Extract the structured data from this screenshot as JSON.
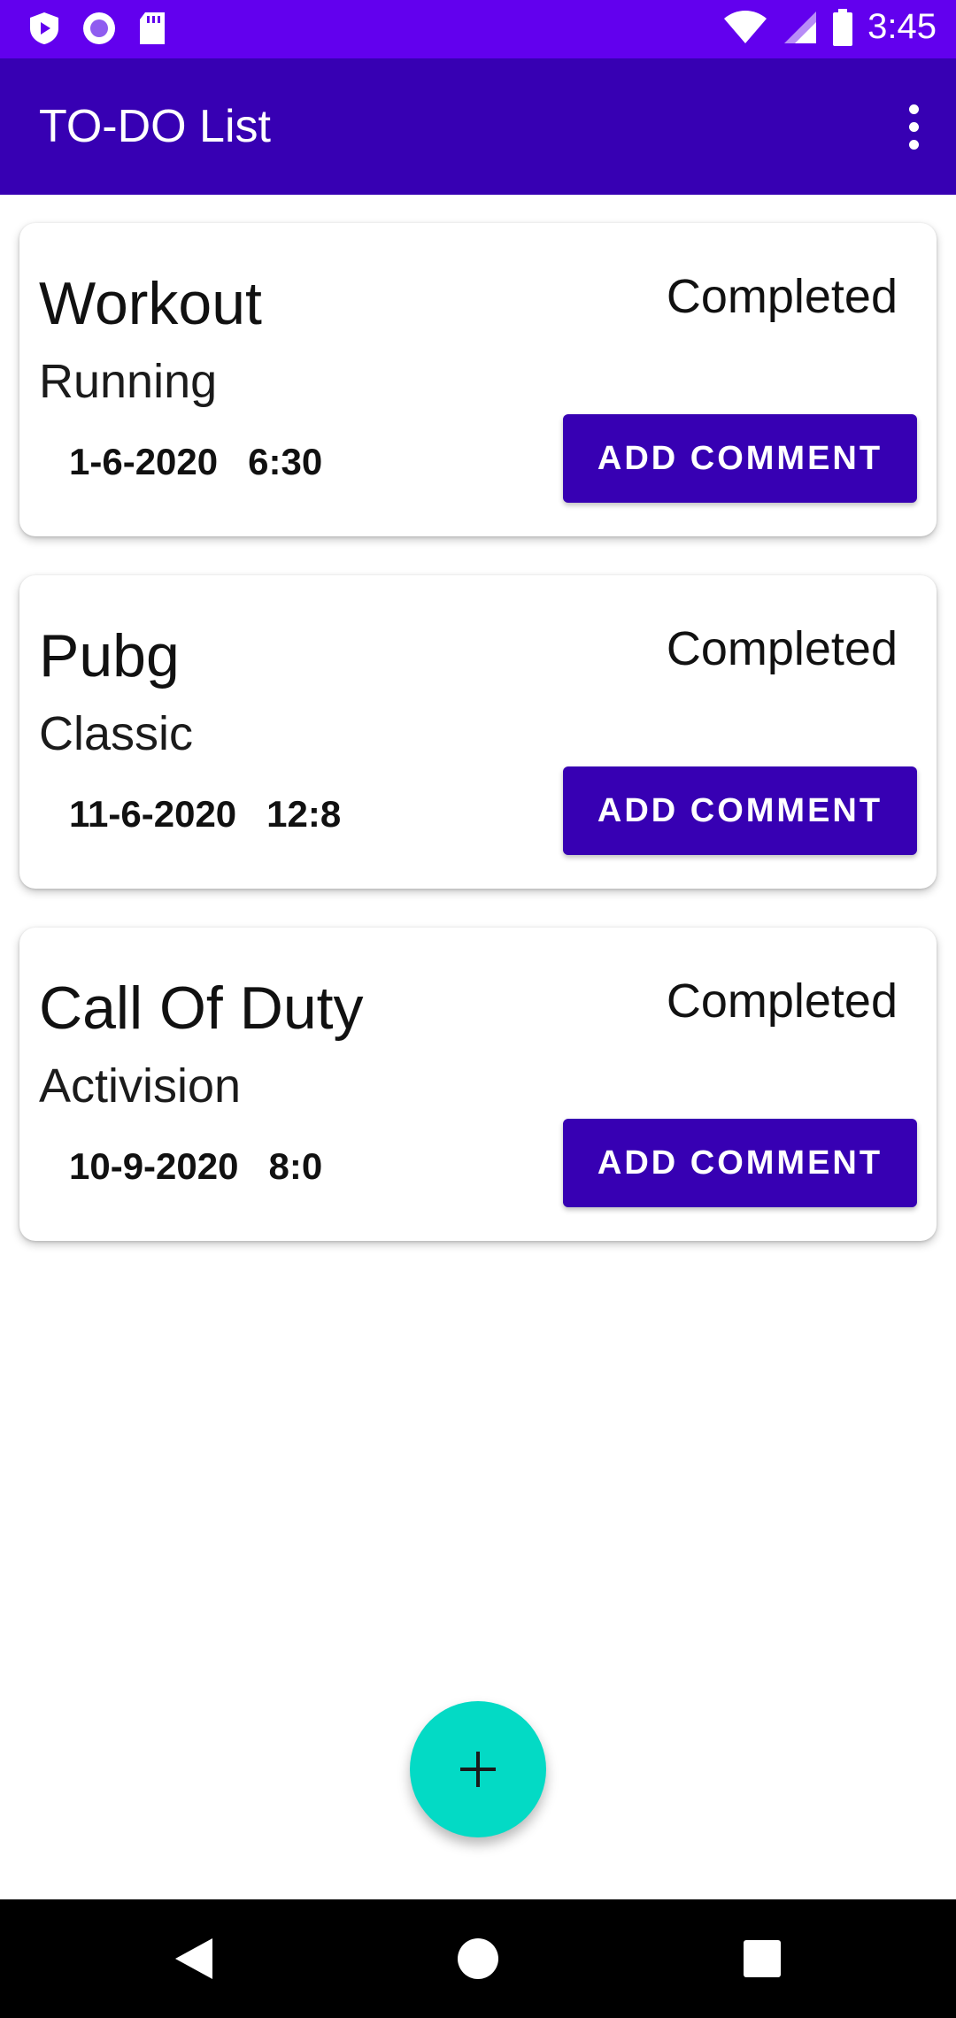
{
  "status_bar": {
    "time": "3:45",
    "icons": [
      "shield-play-icon",
      "record-icon",
      "sd-card-icon",
      "wifi-icon",
      "signal-icon",
      "battery-icon"
    ]
  },
  "app_bar": {
    "title": "TO-DO List",
    "menu_icon": "more-vert-icon"
  },
  "tasks": [
    {
      "title": "Workout",
      "subtitle": "Running",
      "status": "Completed",
      "date": "1-6-2020",
      "time": "6:30",
      "button_label": "ADD COMMENT"
    },
    {
      "title": "Pubg",
      "subtitle": "Classic",
      "status": "Completed",
      "date": "11-6-2020",
      "time": "12:8",
      "button_label": "ADD COMMENT"
    },
    {
      "title": "Call Of Duty",
      "subtitle": "Activision",
      "status": "Completed",
      "date": "10-9-2020",
      "time": "8:0",
      "button_label": "ADD COMMENT"
    }
  ],
  "fab": {
    "icon": "plus-icon"
  },
  "nav_bar": {
    "icons": [
      "back-icon",
      "home-icon",
      "recents-icon"
    ]
  },
  "colors": {
    "status_bar": "#6200ee",
    "app_bar": "#3700b3",
    "button": "#3700b3",
    "fab": "#03dac5"
  }
}
